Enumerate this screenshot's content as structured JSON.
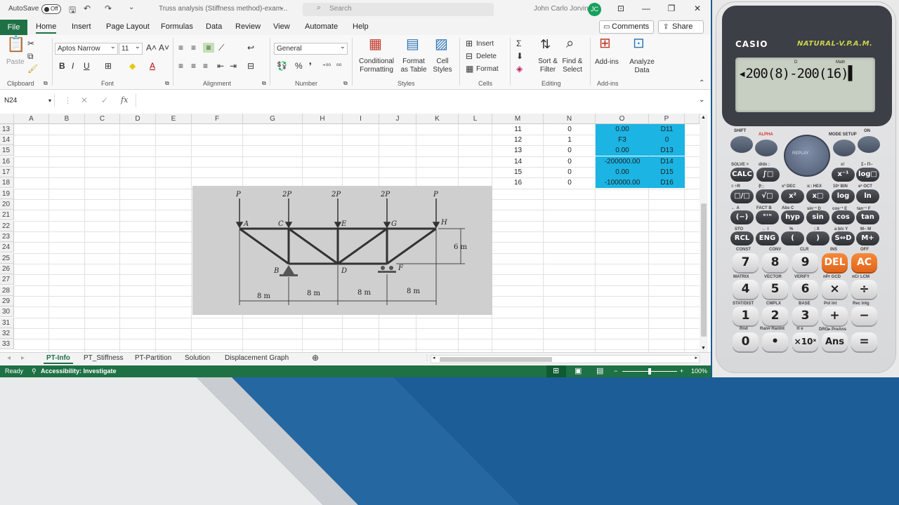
{
  "titlebar": {
    "autosave_label": "AutoSave",
    "autosave_state": "Off",
    "doc_title": "Truss analysis (Stiffness method)-exam...",
    "search_placeholder": "Search",
    "user_name": "John Carlo Jorvina",
    "user_initials": "JC"
  },
  "menu": {
    "tabs": [
      "File",
      "Home",
      "Insert",
      "Page Layout",
      "Formulas",
      "Data",
      "Review",
      "View",
      "Automate",
      "Help"
    ],
    "comments_label": "Comments",
    "share_label": "Share"
  },
  "ribbon": {
    "groups": [
      "Clipboard",
      "Font",
      "Alignment",
      "Number",
      "Styles",
      "Cells",
      "Editing",
      "Add-ins"
    ],
    "paste_label": "Paste",
    "font_name": "Aptos Narrow",
    "font_size": "11",
    "number_format": "General",
    "conditional_formatting": "Conditional Formatting",
    "format_as_table": "Format as Table",
    "cell_styles": "Cell Styles",
    "insert_label": "Insert",
    "delete_label": "Delete",
    "format_label": "Format",
    "sort_filter": "Sort & Filter",
    "find_select": "Find & Select",
    "add_ins": "Add-ins",
    "analyze_data": "Analyze Data"
  },
  "formula_bar": {
    "name_box": "N24",
    "fx": "fx",
    "formula": ""
  },
  "grid": {
    "columns": [
      "A",
      "B",
      "C",
      "D",
      "E",
      "F",
      "G",
      "H",
      "I",
      "J",
      "K",
      "L",
      "M",
      "N",
      "O",
      "P"
    ],
    "rows": [
      "13",
      "14",
      "15",
      "16",
      "17",
      "18",
      "19",
      "20",
      "21",
      "22",
      "23",
      "24",
      "25",
      "26",
      "27",
      "28",
      "29",
      "30",
      "31",
      "32",
      "33"
    ],
    "data_rows": [
      {
        "m": "11",
        "n": "0",
        "o": "0.00",
        "p": "D11"
      },
      {
        "m": "12",
        "n": "1",
        "o": "F3",
        "p": "0"
      },
      {
        "m": "13",
        "n": "0",
        "o": "0.00",
        "p": "D13"
      },
      {
        "m": "14",
        "n": "0",
        "o": "-200000.00",
        "p": "D14"
      },
      {
        "m": "15",
        "n": "0",
        "o": "0.00",
        "p": "D15"
      },
      {
        "m": "16",
        "n": "0",
        "o": "-100000.00",
        "p": "D16"
      }
    ],
    "highlight_color": "#1bb4e3"
  },
  "truss_figure": {
    "loads": [
      "P",
      "2P",
      "2P",
      "2P",
      "P"
    ],
    "nodes": [
      "A",
      "C",
      "E",
      "G",
      "H",
      "B",
      "D",
      "F"
    ],
    "spans": [
      "8 m",
      "8 m",
      "8 m",
      "8 m"
    ],
    "height": "6 m"
  },
  "sheet_tabs": [
    "PT-Info",
    "PT_Stiffness",
    "PT-Partition",
    "Solution",
    "Displacement Graph"
  ],
  "status": {
    "ready": "Ready",
    "accessibility": "Accessibility: Investigate",
    "zoom": "100%",
    "accent": "#1e7145"
  },
  "calculator": {
    "brand": "CASIO",
    "model": "NATURAL-V.P.A.M.",
    "lcd_indicator_1": "D",
    "lcd_indicator_2": "Math",
    "lcd_expression": "◂200(8)-200(16)▌",
    "top_labels": [
      "SHIFT",
      "ALPHA",
      "MODE SETUP",
      "ON",
      "REPLAY"
    ],
    "func_row1": [
      "CALC",
      "∫□",
      "x⁻¹",
      "log□"
    ],
    "func_row2": [
      "□/□",
      "√□",
      "x²",
      "x□",
      "log",
      "ln"
    ],
    "func_row3": [
      "(−)",
      "°'\"",
      "hyp",
      "sin",
      "cos",
      "tan"
    ],
    "func_row4": [
      "RCL",
      "ENG",
      "(",
      ")",
      "S⇔D",
      "M+"
    ],
    "num_row1": [
      "7",
      "8",
      "9",
      "DEL",
      "AC"
    ],
    "num_row2": [
      "4",
      "5",
      "6",
      "×",
      "÷"
    ],
    "num_row3": [
      "1",
      "2",
      "3",
      "+",
      "−"
    ],
    "num_row4": [
      "0",
      "•",
      "×10ˣ",
      "Ans",
      "="
    ],
    "sub_labels_row1": [
      "SOLVE =",
      "d/dx :",
      "x!",
      "Σ− Π−"
    ],
    "sub_labels_row2": [
      "≡ ÷R",
      "∛□",
      "x³ DEC",
      "x□ HEX",
      "10ˣ BIN",
      "eˣ OCT"
    ],
    "sub_labels_row3": [
      "← A",
      "FACT B",
      "Abs C",
      "sin⁻¹ D",
      "cos⁻¹ E",
      "tan⁻¹ F"
    ],
    "sub_labels_row4": [
      "STO",
      "← i",
      "%",
      "; X",
      "a b/c Y",
      "M− M"
    ],
    "sub_labels_num1": [
      "CONST",
      "CONV",
      "CLR",
      "INS",
      "OFF"
    ],
    "sub_labels_num2": [
      "MATRIX",
      "VECTOR",
      "VERIFY",
      "nPr GCD",
      "nCr LCM"
    ],
    "sub_labels_num3": [
      "STAT/DIST",
      "CMPLX",
      "BASE",
      "Pol Int",
      "Rec Intg"
    ],
    "sub_labels_num4": [
      "Rnd",
      "Ran# RanInt",
      "π e",
      "DRG▸ PreAns",
      ""
    ]
  }
}
